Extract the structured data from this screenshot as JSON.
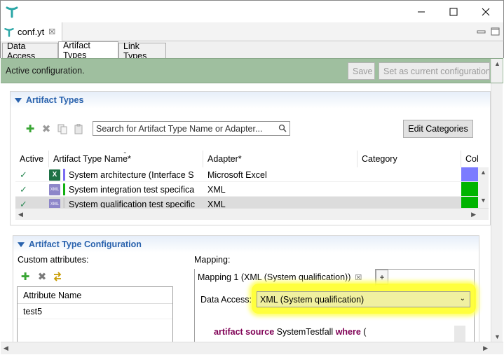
{
  "editor_tab": {
    "label": "conf.yt",
    "close": "☒"
  },
  "main_tabs": [
    {
      "label": "Data Access",
      "active": false
    },
    {
      "label": "Artifact Types",
      "active": true
    },
    {
      "label": "Link Types",
      "active": false
    }
  ],
  "status": {
    "text": "Active configuration.",
    "save_label": "Save",
    "set_current_label": "Set as current configuration"
  },
  "artifact_types": {
    "title": "Artifact Types",
    "search_placeholder": "Search for Artifact Type Name or Adapter...",
    "edit_categories_label": "Edit Categories",
    "columns": [
      "Active",
      "Artifact Type Name*",
      "Adapter*",
      "Category",
      "Col"
    ],
    "rows": [
      {
        "active": "✓",
        "icon": "X",
        "icon_kind": "excel",
        "bar_color": "#7b6cf2",
        "name": "System architecture (Interface S",
        "adapter": "Microsoft Excel",
        "category": "",
        "color": "#7b7bff"
      },
      {
        "active": "✓",
        "icon": "XML",
        "icon_kind": "xml",
        "bar_color": "#12b012",
        "name": "System integration test specifica",
        "adapter": "XML",
        "category": "",
        "color": "#00b400"
      },
      {
        "active": "✓",
        "icon": "XML",
        "icon_kind": "xml",
        "bar_color": "#cfcfcf",
        "name": "System qualification test specific",
        "adapter": "XML",
        "category": "",
        "color": "#00b400"
      }
    ]
  },
  "config": {
    "title": "Artifact Type Configuration",
    "custom_attributes_label": "Custom attributes:",
    "attr_header": "Attribute Name",
    "attributes": [
      "test5"
    ],
    "mapping_label": "Mapping:",
    "mapping_tab": "Mapping 1 (XML (System qualification))",
    "mapping_tab_close": "☒",
    "mapping_add": "+",
    "data_access_label": "Data Access:",
    "data_access_value": "XML (System qualification)",
    "code": {
      "kw1": "artifact source",
      "ident": " SystemTestfall ",
      "kw2": "where",
      "rest": " ("
    }
  }
}
